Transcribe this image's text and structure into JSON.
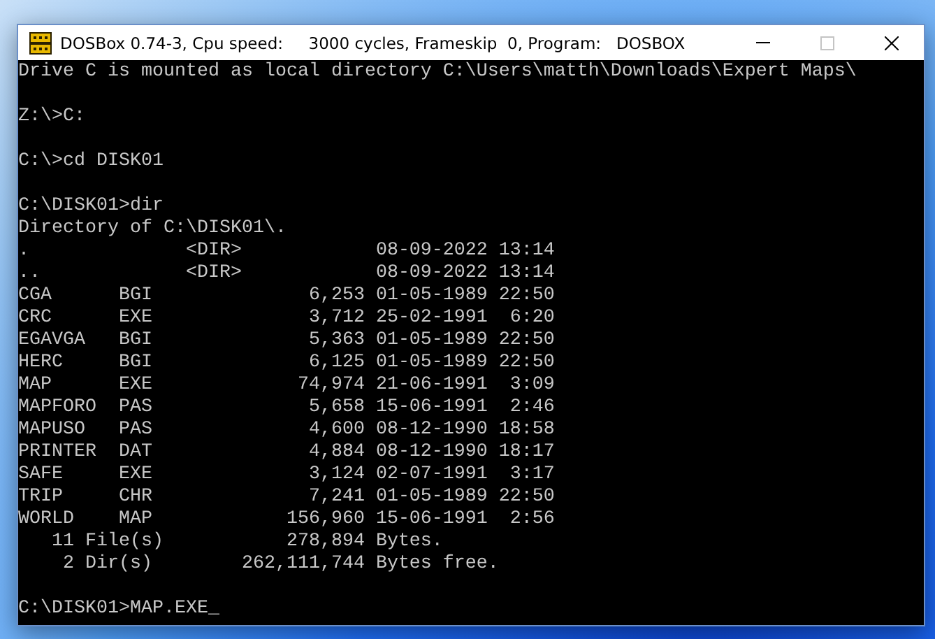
{
  "window": {
    "title": "DOSBox 0.74-3, Cpu speed:     3000 cycles, Frameskip  0, Program:   DOSBOX",
    "controls": [
      {
        "kind": "minimize",
        "disabled": false
      },
      {
        "kind": "maximize",
        "disabled": true
      },
      {
        "kind": "close",
        "disabled": false
      }
    ]
  },
  "console": {
    "blocks": [
      [
        "Drive C is mounted as local directory C:\\Users\\matth\\Downloads\\Expert Maps\\"
      ],
      [
        "Z:\\>C:"
      ],
      [
        "C:\\>cd DISK01"
      ],
      [
        "C:\\DISK01>dir",
        "Directory of C:\\DISK01\\.",
        ".              <DIR>            08-09-2022 13:14",
        "..             <DIR>            08-09-2022 13:14",
        "CGA      BGI              6,253 01-05-1989 22:50",
        "CRC      EXE              3,712 25-02-1991  6:20",
        "EGAVGA   BGI              5,363 01-05-1989 22:50",
        "HERC     BGI              6,125 01-05-1989 22:50",
        "MAP      EXE             74,974 21-06-1991  3:09",
        "MAPFORO  PAS              5,658 15-06-1991  2:46",
        "MAPUSO   PAS              4,600 08-12-1990 18:58",
        "PRINTER  DAT              4,884 08-12-1990 18:17",
        "SAFE     EXE              3,124 02-07-1991  3:17",
        "TRIP     CHR              7,241 01-05-1989 22:50",
        "WORLD    MAP            156,960 15-06-1991  2:56",
        "   11 File(s)           278,894 Bytes.",
        "    2 Dir(s)        262,111,744 Bytes free."
      ],
      [
        "C:\\DISK01>MAP.EXE_"
      ]
    ]
  }
}
